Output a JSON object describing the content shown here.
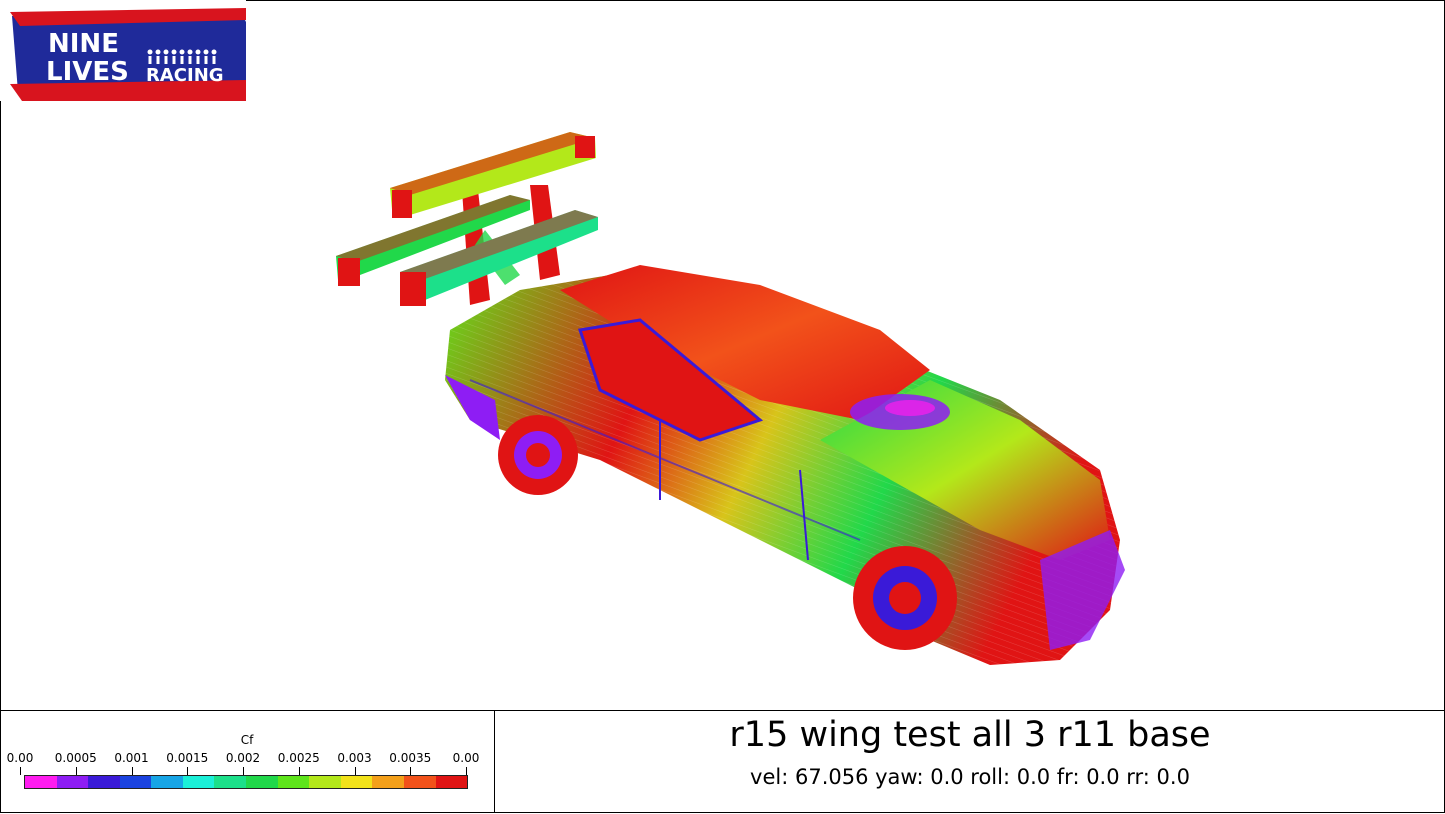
{
  "logo": {
    "line1": "NINE",
    "line2": "LIVES",
    "line3": "RACING"
  },
  "legend": {
    "title": "Cf",
    "ticks": [
      "0.00",
      "0.0005",
      "0.001",
      "0.0015",
      "0.002",
      "0.0025",
      "0.003",
      "0.0035",
      "0.00"
    ],
    "colors": [
      "#ff1cf0",
      "#8e1df4",
      "#3a1ad8",
      "#1b43e0",
      "#17a5e6",
      "#1bf0d8",
      "#1ce08a",
      "#21d84a",
      "#5ee51b",
      "#b3e81a",
      "#f2e21a",
      "#f4a01a",
      "#f2521a",
      "#e01414"
    ]
  },
  "info": {
    "title": "r15 wing test all 3 r11 base",
    "params": "vel: 67.056 yaw: 0.0 roll: 0.0 fr: 0.0 rr: 0.0"
  },
  "scene": {
    "object": "car-cf-visualization"
  }
}
